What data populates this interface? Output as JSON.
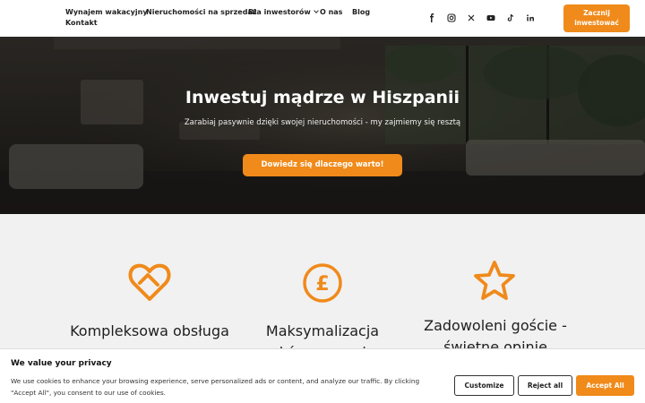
{
  "nav": {
    "items": [
      "Wynajem wakacyjny",
      "Nieruchomości na sprzedaż",
      "Dla inwestorów",
      "O nas",
      "Blog",
      "Kontakt"
    ],
    "cta": "Zacznij inwestować"
  },
  "social": [
    "f",
    "ig",
    "x",
    "yt",
    "tt",
    "in"
  ],
  "hero": {
    "title": "Inwestuj mądrze w Hiszpanii",
    "subtitle": "Zarabiaj pasywnie dzięki swojej nieruchomości - my zajmiemy się resztą",
    "button": "Dowiedz się dlaczego warto!"
  },
  "features": [
    {
      "icon": "heart-icon",
      "title": "Kompleksowa obsługa"
    },
    {
      "icon": "pound-coin-icon",
      "title": "Maksymalizacja zysków z wynajmu"
    },
    {
      "icon": "star-icon",
      "title": "Zadowoleni goście - świetne opinie"
    }
  ],
  "cookie": {
    "title": "We value your privacy",
    "text": "We use cookies to enhance your browsing experience, serve personalized ads or content, and analyze our traffic. By clicking \"Accept All\", you consent to our use of cookies.",
    "customize": "Customize",
    "reject": "Reject all",
    "accept": "Accept All"
  },
  "colors": {
    "accent": "#f08a1a",
    "hero_bg": "#2a2723"
  }
}
